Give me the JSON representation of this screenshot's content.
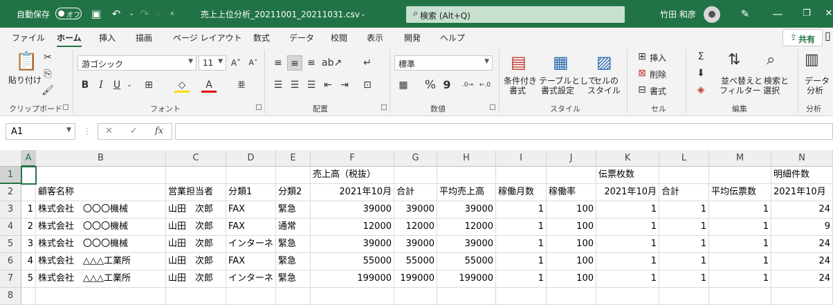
{
  "titlebar": {
    "autosave_label": "自動保存",
    "autosave_state": "オフ",
    "file_title": "売上上位分析_20211001_20211031.csv",
    "search_placeholder": "検索 (Alt+Q)",
    "user_name": "竹田 和彦",
    "bg_color": "#217346"
  },
  "menu_tabs": [
    "ファイル",
    "ホーム",
    "挿入",
    "描画",
    "ページ レイアウト",
    "数式",
    "データ",
    "校閲",
    "表示",
    "開発",
    "ヘルプ"
  ],
  "active_tab": "ホーム",
  "share_label": "共有",
  "ribbon": {
    "clipboard": {
      "paste": "貼り付け",
      "group": "クリップボード"
    },
    "font": {
      "family": "游ゴシック",
      "size": "11",
      "bold": "B",
      "italic": "I",
      "underline": "U",
      "group": "フォント"
    },
    "alignment": {
      "group": "配置"
    },
    "number": {
      "format": "標準",
      "percent": "%",
      "comma": "9",
      "group": "数値"
    },
    "styles": {
      "conditional_line1": "条件付き",
      "conditional_line2": "書式",
      "table_line1": "テーブルとして",
      "table_line2": "書式設定",
      "cell_line1": "セルの",
      "cell_line2": "スタイル",
      "group": "スタイル"
    },
    "cells": {
      "insert": "挿入",
      "delete": "削除",
      "format": "書式",
      "group": "セル"
    },
    "editing": {
      "sort_line1": "並べ替えと",
      "sort_line2": "フィルター",
      "find_line1": "検索と",
      "find_line2": "選択",
      "group": "編集"
    },
    "analysis": {
      "line1": "データ",
      "line2": "分析",
      "group": "分析"
    }
  },
  "formula_bar": {
    "name_box": "A1",
    "cancel": "✕",
    "enter": "✓",
    "fx": "fx",
    "formula": ""
  },
  "sheet": {
    "columns": [
      "A",
      "B",
      "C",
      "D",
      "E",
      "F",
      "G",
      "H",
      "I",
      "J",
      "K",
      "L",
      "M",
      "N"
    ],
    "row_numbers": [
      "1",
      "2",
      "3",
      "4",
      "5",
      "6",
      "7",
      "8"
    ],
    "row1": {
      "F": "売上高（税抜）",
      "K": "伝票枚数",
      "N": "明細件数"
    },
    "row2": {
      "B": "顧客名称",
      "C": "営業担当者",
      "D": "分類1",
      "E": "分類2",
      "F": "2021年10月",
      "G": "合計",
      "H": "平均売上高",
      "I": "稼働月数",
      "J": "稼働率",
      "K": "2021年10月",
      "L": "合計",
      "M": "平均伝票数",
      "N": "2021年10月"
    },
    "rows": [
      {
        "A": "1",
        "B": "株式会社　〇〇〇機械",
        "C": "山田　次郎",
        "D": "FAX",
        "E": "緊急",
        "F": "39000",
        "G": "39000",
        "H": "39000",
        "I": "1",
        "J": "100",
        "K": "1",
        "L": "1",
        "M": "1",
        "N": "24"
      },
      {
        "A": "2",
        "B": "株式会社　〇〇〇機械",
        "C": "山田　次郎",
        "D": "FAX",
        "E": "通常",
        "F": "12000",
        "G": "12000",
        "H": "12000",
        "I": "1",
        "J": "100",
        "K": "1",
        "L": "1",
        "M": "1",
        "N": "9"
      },
      {
        "A": "3",
        "B": "株式会社　〇〇〇機械",
        "C": "山田　次郎",
        "D": "インターネ",
        "E": "緊急",
        "F": "39000",
        "G": "39000",
        "H": "39000",
        "I": "1",
        "J": "100",
        "K": "1",
        "L": "1",
        "M": "1",
        "N": "24"
      },
      {
        "A": "4",
        "B": "株式会社　△△△工業所",
        "C": "山田　次郎",
        "D": "FAX",
        "E": "緊急",
        "F": "55000",
        "G": "55000",
        "H": "55000",
        "I": "1",
        "J": "100",
        "K": "1",
        "L": "1",
        "M": "1",
        "N": "24"
      },
      {
        "A": "5",
        "B": "株式会社　△△△工業所",
        "C": "山田　次郎",
        "D": "インターネ",
        "E": "緊急",
        "F": "199000",
        "G": "199000",
        "H": "199000",
        "I": "1",
        "J": "100",
        "K": "1",
        "L": "1",
        "M": "1",
        "N": "24"
      }
    ]
  }
}
